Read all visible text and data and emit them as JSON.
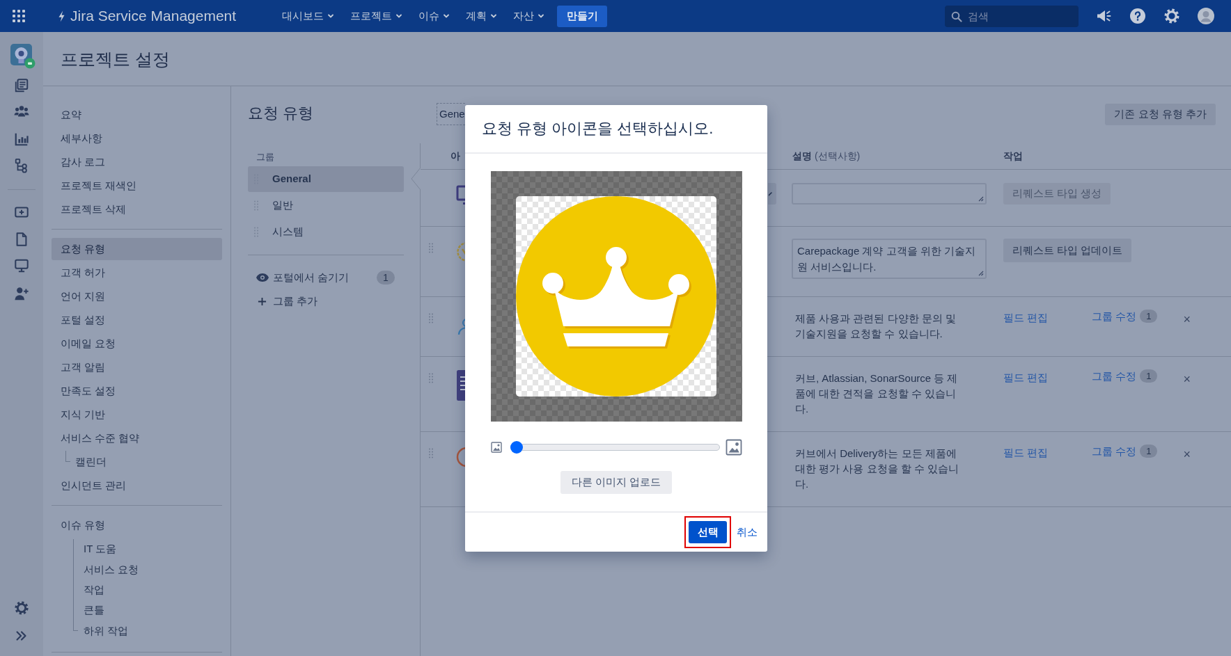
{
  "top_nav": {
    "product_name": "Jira Service Management",
    "menus": [
      "대시보드",
      "프로젝트",
      "이슈",
      "계획",
      "자산"
    ],
    "create_button": "만들기",
    "search": {
      "placeholder": "검색"
    }
  },
  "page_header": {
    "title": "프로젝트 설정"
  },
  "settings_nav": {
    "sections": [
      {
        "items": [
          {
            "label": "요약",
            "selected": false
          },
          {
            "label": "세부사항",
            "selected": false
          },
          {
            "label": "감사 로그",
            "selected": false
          },
          {
            "label": "프로젝트 재색인",
            "selected": false
          },
          {
            "label": "프로젝트 삭제",
            "selected": false
          }
        ]
      },
      {
        "items": [
          {
            "label": "요청 유형",
            "selected": true
          },
          {
            "label": "고객 허가",
            "selected": false
          },
          {
            "label": "언어 지원",
            "selected": false
          },
          {
            "label": "포털 설정",
            "selected": false
          },
          {
            "label": "이메일 요청",
            "selected": false
          },
          {
            "label": "고객 알림",
            "selected": false
          },
          {
            "label": "만족도 설정",
            "selected": false
          },
          {
            "label": "지식 기반",
            "selected": false
          },
          {
            "label": "서비스 수준 협약",
            "selected": false,
            "children": [
              {
                "label": "캘린더",
                "selected": false
              }
            ]
          },
          {
            "label": "인시던트 관리",
            "selected": false
          }
        ]
      },
      {
        "items": [
          {
            "label": "이슈 유형",
            "selected": false,
            "children": [
              {
                "label": "IT 도움",
                "selected": false
              },
              {
                "label": "서비스 요청",
                "selected": false
              },
              {
                "label": "작업",
                "selected": false
              },
              {
                "label": "큰틀",
                "selected": false
              },
              {
                "label": "하위 작업",
                "selected": false
              }
            ]
          }
        ]
      }
    ]
  },
  "request_types": {
    "title": "요청 유형",
    "groups_label": "그룹",
    "groups": [
      {
        "label": "General",
        "selected": true
      },
      {
        "label": "일반",
        "selected": false
      },
      {
        "label": "시스템",
        "selected": false
      }
    ],
    "hidden_from_portal": {
      "label": "포털에서 숨기기",
      "count": "1"
    },
    "add_group": "그룹 추가"
  },
  "group_name_field": {
    "value": "Gene"
  },
  "add_existing_button": "기존 요청 유형 추가",
  "table": {
    "columns": [
      {
        "label": "아"
      },
      {
        "label": "설명",
        "note": "(선택사항)"
      },
      {
        "label": "작업"
      }
    ],
    "rows": [
      {
        "kind": "new",
        "create_button": {
          "label": "리퀘스트 타입 생성",
          "disabled": true
        }
      },
      {
        "kind": "editing",
        "description": "Carepackage 계약 고객을 위한 기술지원 서비스입니다.",
        "update_button": "리퀘스트 타입 업데이트"
      },
      {
        "kind": "normal",
        "description": "제품 사용과 관련된 다양한 문의 및 기술지원을 요청할 수 있습니다.",
        "edit_fields": "필드 편집",
        "edit_group": "그룹 수정",
        "group_count": "1",
        "remove": "×"
      },
      {
        "kind": "normal",
        "description": "커브, Atlassian, SonarSource 등 제품에 대한 견적을 요청할 수 있습니다.",
        "edit_fields": "필드 편집",
        "edit_group": "그룹 수정",
        "group_count": "1",
        "remove": "×"
      },
      {
        "kind": "normal",
        "description": "커브에서 Delivery하는 모든 제품에 대한 평가 사용 요청을 할 수 있습니다.",
        "edit_fields": "필드 편집",
        "edit_group": "그룹 수정",
        "group_count": "1",
        "remove": "×"
      }
    ]
  },
  "modal": {
    "title": "요청 유형 아이콘을 선택하십시오.",
    "zoom_slider": {
      "level": 0
    },
    "upload_button": "다른 이미지 업로드",
    "select_button": {
      "label": "선택",
      "highlighted": true
    },
    "cancel_link": "취소"
  }
}
